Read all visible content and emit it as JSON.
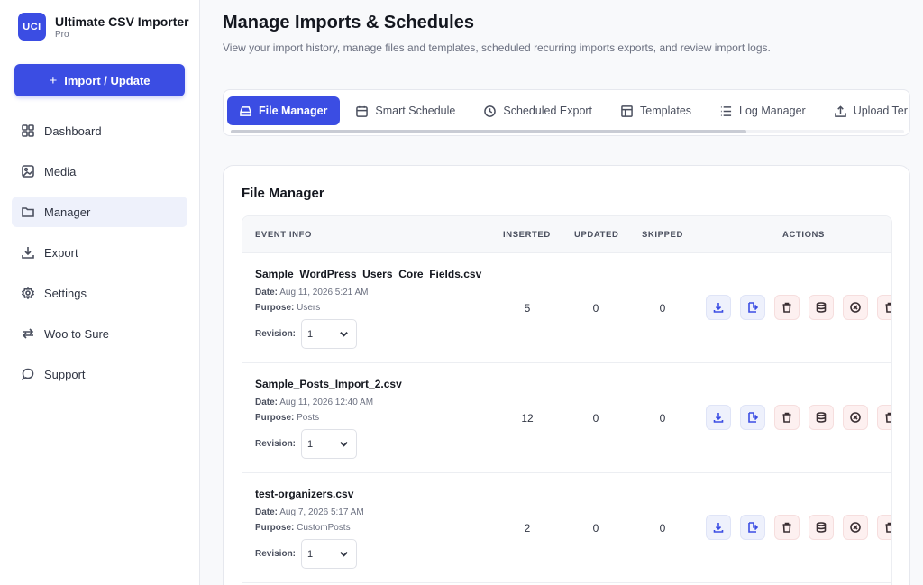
{
  "app": {
    "logo_text": "UCI",
    "name": "Ultimate CSV Importer",
    "edition": "Pro",
    "primary_action": "Import / Update"
  },
  "nav": {
    "items": [
      {
        "label": "Dashboard",
        "icon": "grid-icon"
      },
      {
        "label": "Media",
        "icon": "image-icon"
      },
      {
        "label": "Manager",
        "icon": "folder-icon",
        "active": true
      },
      {
        "label": "Export",
        "icon": "download-icon"
      },
      {
        "label": "Settings",
        "icon": "gear-icon"
      },
      {
        "label": "Woo to Sure",
        "icon": "swap-icon"
      },
      {
        "label": "Support",
        "icon": "chat-icon"
      }
    ]
  },
  "page": {
    "title": "Manage Imports & Schedules",
    "description": "View your import history, manage files and templates, scheduled recurring imports exports, and review import logs."
  },
  "tabs": [
    {
      "label": "File Manager",
      "icon": "drive-icon",
      "active": true
    },
    {
      "label": "Smart Schedule",
      "icon": "calendar-icon"
    },
    {
      "label": "Scheduled Export",
      "icon": "clock-icon"
    },
    {
      "label": "Templates",
      "icon": "layout-icon"
    },
    {
      "label": "Log Manager",
      "icon": "list-icon"
    },
    {
      "label": "Upload Ter",
      "icon": "upload-icon"
    }
  ],
  "file_manager": {
    "title": "File Manager",
    "columns": {
      "event": "EVENT INFO",
      "inserted": "INSERTED",
      "updated": "UPDATED",
      "skipped": "SKIPPED",
      "actions": "ACTIONS"
    },
    "labels": {
      "date": "Date:",
      "purpose": "Purpose:",
      "revision": "Revision:"
    },
    "rows": [
      {
        "file": "Sample_WordPress_Users_Core_Fields.csv",
        "date": "Aug 11, 2026 5:21 AM",
        "purpose": "Users",
        "revision": "1",
        "inserted": "5",
        "updated": "0",
        "skipped": "0"
      },
      {
        "file": "Sample_Posts_Import_2.csv",
        "date": "Aug 11, 2026 12:40 AM",
        "purpose": "Posts",
        "revision": "1",
        "inserted": "12",
        "updated": "0",
        "skipped": "0"
      },
      {
        "file": "test-organizers.csv",
        "date": "Aug 7, 2026 5:17 AM",
        "purpose": "CustomPosts",
        "revision": "1",
        "inserted": "2",
        "updated": "0",
        "skipped": "0"
      }
    ],
    "row_actions": [
      "download-icon",
      "export-file-icon",
      "trash-icon",
      "database-icon",
      "cancel-circle-icon",
      "trash-icon"
    ]
  },
  "colors": {
    "accent": "#3b4de3",
    "active_nav_bg": "#eef1fb",
    "danger_bg": "#fdf0f0"
  }
}
